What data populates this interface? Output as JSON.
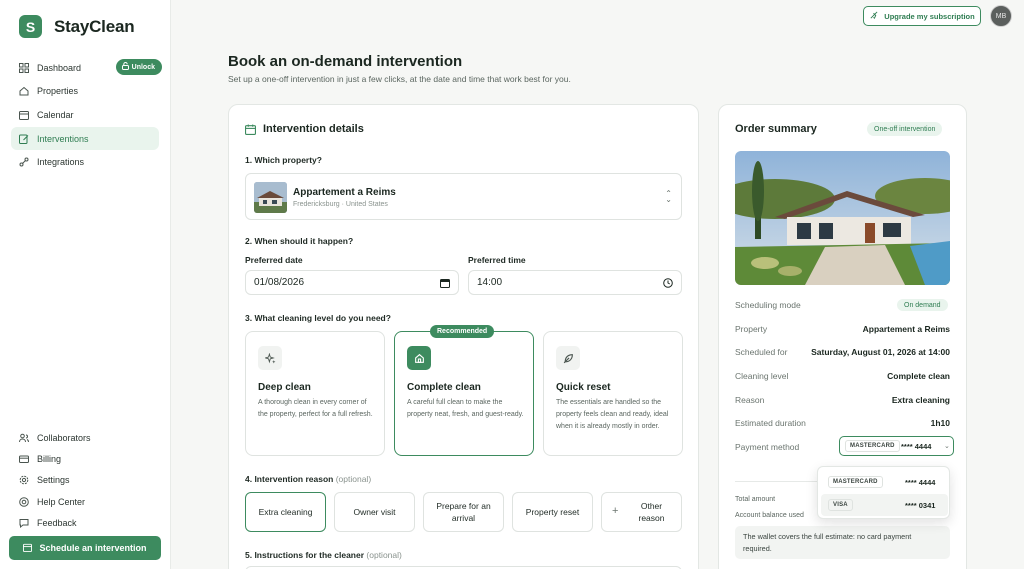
{
  "brand": {
    "logo_letter": "S",
    "name": "StayClean"
  },
  "sidebar": {
    "items": [
      {
        "label": "Dashboard",
        "icon": "dashboard-icon"
      },
      {
        "label": "Properties",
        "icon": "home-icon"
      },
      {
        "label": "Calendar",
        "icon": "calendar-icon"
      },
      {
        "label": "Interventions",
        "icon": "edit-icon",
        "active": true
      },
      {
        "label": "Integrations",
        "icon": "integrations-icon"
      }
    ],
    "unlock_label": "Unlock",
    "bottom_items": [
      {
        "label": "Collaborators",
        "icon": "users-icon"
      },
      {
        "label": "Billing",
        "icon": "card-icon"
      },
      {
        "label": "Settings",
        "icon": "gear-icon"
      },
      {
        "label": "Help Center",
        "icon": "help-icon"
      },
      {
        "label": "Feedback",
        "icon": "feedback-icon"
      }
    ],
    "schedule_button": "Schedule an intervention"
  },
  "topbar": {
    "upgrade_label": "Upgrade my subscription",
    "avatar_initials": "MB"
  },
  "page": {
    "title": "Book an on-demand intervention",
    "subtitle": "Set up a one-off intervention in just a few clicks, at the date and time that work best for you."
  },
  "details": {
    "title": "Intervention details",
    "q1": "1. Which property?",
    "property": {
      "name": "Appartement a Reims",
      "location": "Fredericksburg · United States"
    },
    "q2": "2. When should it happen?",
    "date_label": "Preferred date",
    "date_value": "01/08/2026",
    "time_label": "Preferred time",
    "time_value": "14:00",
    "q3": "3. What cleaning level do you need?",
    "recommended": "Recommended",
    "levels": [
      {
        "title": "Deep clean",
        "desc": "A thorough clean in every corner of the property, perfect for a full refresh.",
        "icon": "sparkles-icon"
      },
      {
        "title": "Complete clean",
        "desc": "A careful full clean to make the property neat, fresh, and guest-ready.",
        "icon": "house-icon",
        "selected": true
      },
      {
        "title": "Quick reset",
        "desc": "The essentials are handled so the property feels clean and ready, ideal when it is already mostly in order.",
        "icon": "leaf-icon"
      }
    ],
    "q4": "4. Intervention reason",
    "q4_optional": "(optional)",
    "reasons": [
      "Extra cleaning",
      "Owner visit",
      "Prepare for an arrival",
      "Property reset",
      "Other reason"
    ],
    "q5": "5. Instructions for the cleaner",
    "q5_optional": "(optional)"
  },
  "summary": {
    "title": "Order summary",
    "badge": "One-off intervention",
    "rows": [
      {
        "key": "Scheduling mode",
        "value": "On demand"
      },
      {
        "key": "Property",
        "value": "Appartement a Reims"
      },
      {
        "key": "Scheduled for",
        "value": "Saturday, August 01, 2026 at 14:00"
      },
      {
        "key": "Cleaning level",
        "value": "Complete clean"
      },
      {
        "key": "Reason",
        "value": "Extra cleaning"
      },
      {
        "key": "Estimated duration",
        "value": "1h10"
      },
      {
        "key": "Payment method",
        "value": ""
      }
    ],
    "payment": {
      "brand": "MASTERCARD",
      "number": "**** 4444"
    },
    "dropdown": [
      {
        "brand": "MASTERCARD",
        "number": "**** 4444"
      },
      {
        "brand": "VISA",
        "number": "**** 0341"
      }
    ],
    "total_label": "Total amount",
    "balance_label": "Account balance used",
    "wallet_note": "The wallet covers the full estimate: no card payment required."
  }
}
